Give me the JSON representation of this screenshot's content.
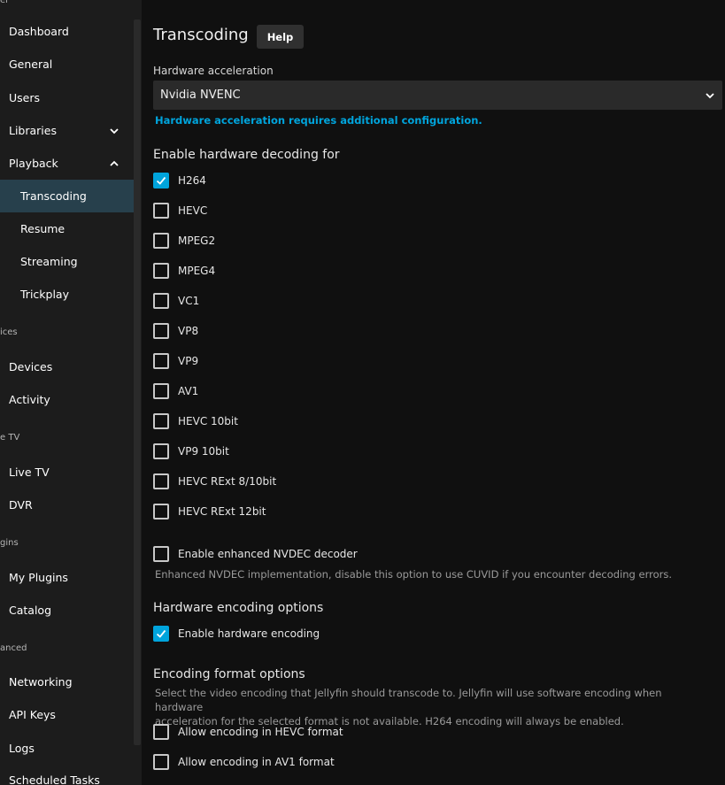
{
  "sidebar": {
    "top_fragment": "er",
    "items": [
      {
        "label": "Dashboard"
      },
      {
        "label": "General"
      },
      {
        "label": "Users"
      },
      {
        "label": "Libraries",
        "chevron": "chevron-down-icon"
      },
      {
        "label": "Playback",
        "chevron": "chevron-up-icon"
      },
      {
        "label": "Transcoding",
        "active": true
      },
      {
        "label": "Resume"
      },
      {
        "label": "Streaming"
      },
      {
        "label": "Trickplay"
      },
      {
        "label": "Devices"
      },
      {
        "label": "Activity"
      },
      {
        "label": "Live TV"
      },
      {
        "label": "DVR"
      },
      {
        "label": "My Plugins"
      },
      {
        "label": "Catalog"
      },
      {
        "label": "Networking"
      },
      {
        "label": "API Keys"
      },
      {
        "label": "Logs"
      },
      {
        "label": "Scheduled Tasks"
      }
    ],
    "headers": [
      "ices",
      "e TV",
      "gins",
      "anced"
    ]
  },
  "main": {
    "title": "Transcoding",
    "help_label": "Help",
    "hw_accel_label": "Hardware acceleration",
    "hw_accel_value": "Nvidia NVENC",
    "hw_accel_note": "Hardware acceleration requires additional configuration.",
    "decoding_title": "Enable hardware decoding for",
    "decoders": [
      {
        "label": "H264",
        "checked": true
      },
      {
        "label": "HEVC",
        "checked": false
      },
      {
        "label": "MPEG2",
        "checked": false
      },
      {
        "label": "MPEG4",
        "checked": false
      },
      {
        "label": "VC1",
        "checked": false
      },
      {
        "label": "VP8",
        "checked": false
      },
      {
        "label": "VP9",
        "checked": false
      },
      {
        "label": "AV1",
        "checked": false
      },
      {
        "label": "HEVC 10bit",
        "checked": false
      },
      {
        "label": "VP9 10bit",
        "checked": false
      },
      {
        "label": "HEVC RExt 8/10bit",
        "checked": false
      },
      {
        "label": "HEVC RExt 12bit",
        "checked": false
      }
    ],
    "nvdec": {
      "label": "Enable enhanced NVDEC decoder",
      "checked": false
    },
    "nvdec_desc": "Enhanced NVDEC implementation, disable this option to use CUVID if you encounter decoding errors.",
    "encoding_title": "Hardware encoding options",
    "hw_encoding": {
      "label": "Enable hardware encoding",
      "checked": true
    },
    "format_title": "Encoding format options",
    "format_desc_1": "Select the video encoding that Jellyfin should transcode to. Jellyfin will use software encoding when hardware",
    "format_desc_2": "acceleration for the selected format is not available. H264 encoding will always be enabled.",
    "hevc_enc": {
      "label": "Allow encoding in HEVC format",
      "checked": false
    },
    "av1_enc": {
      "label": "Allow encoding in AV1 format",
      "checked": false
    }
  },
  "colors": {
    "accent": "#00a4dc",
    "active_bg": "#27404c",
    "sidebar_bg": "#1c1c1c",
    "page_bg": "#101010"
  }
}
